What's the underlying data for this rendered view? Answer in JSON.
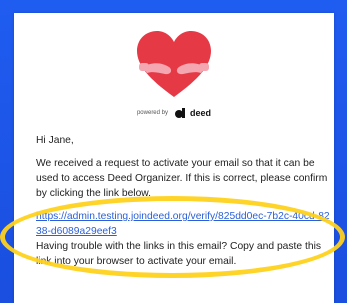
{
  "brand": {
    "powered_by": "powered by",
    "name": "deed",
    "heart_color": "#e63946",
    "arms_color": "#f4a7b0"
  },
  "email": {
    "greeting": "Hi Jane,",
    "paragraph": "We received a request to activate your email so that it can be used to access Deed Organizer. If this is correct, please confirm by clicking the link below.",
    "link": "https://admin.testing.joindeed.org/verify/825dd0ec-7b2c-40cd-8238-d6089a29eef3",
    "trouble": "Having trouble with the links in this email? Copy and paste this link into your browser to activate your email."
  },
  "annotation": {
    "highlight_color": "#ffd21e"
  }
}
